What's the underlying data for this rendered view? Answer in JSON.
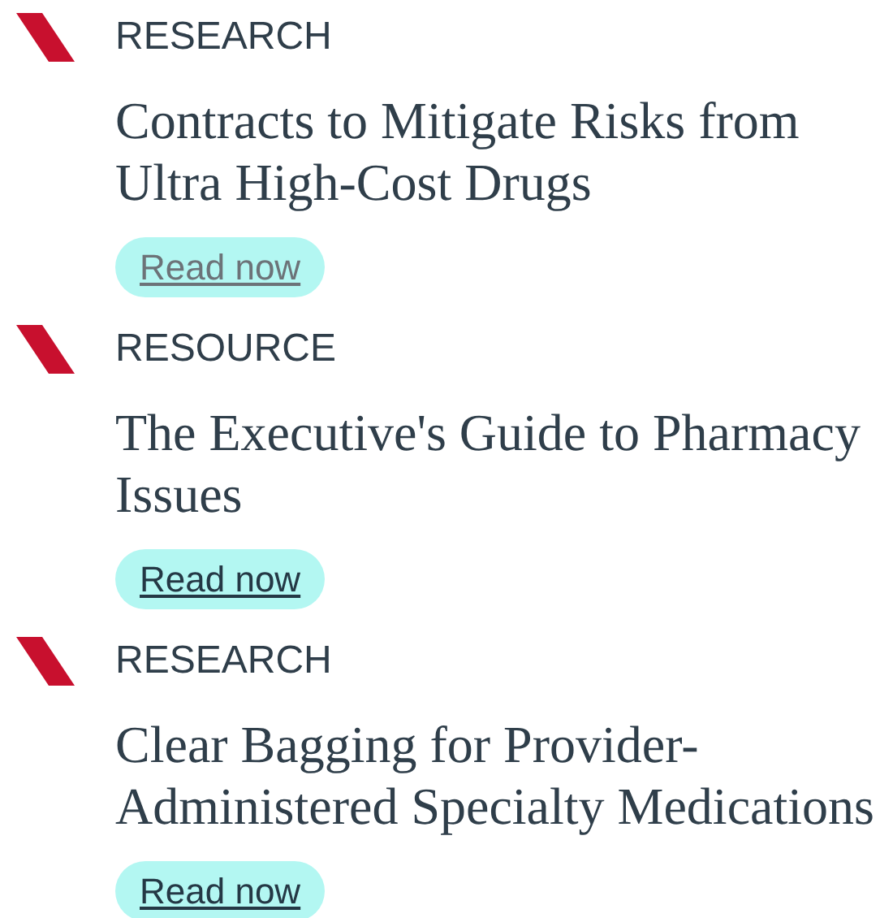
{
  "items": [
    {
      "category": "RESEARCH",
      "title": "Contracts to Mitigate Risks from Ultra High-Cost Drugs",
      "link": {
        "label": "Read now",
        "visited": true
      }
    },
    {
      "category": "RESOURCE",
      "title": "The Executive's Guide to Pharmacy Issues",
      "link": {
        "label": "Read now",
        "visited": false
      }
    },
    {
      "category": "RESEARCH",
      "title": "Clear Bagging for Provider-Administered Specialty Medications",
      "link": {
        "label": "Read now",
        "visited": false
      }
    }
  ]
}
